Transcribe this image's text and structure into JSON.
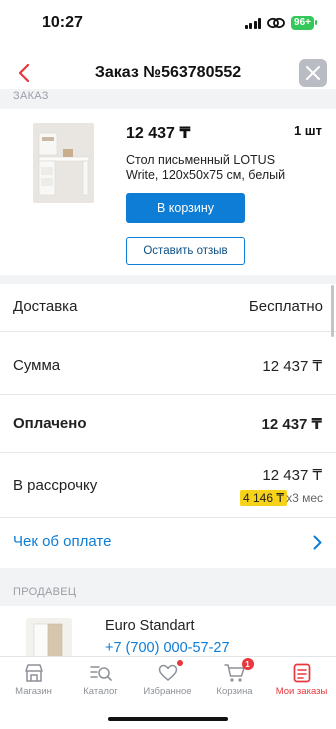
{
  "status_bar": {
    "time": "10:27",
    "battery": "96+"
  },
  "header": {
    "title": "Заказ №563780552"
  },
  "section_order_label": "ЗАКАЗ",
  "product": {
    "price": "12 437 ₸",
    "quantity": "1 шт",
    "name": "Стол письменный LOTUS Write, 120x50x75 см, белый",
    "cart_button": "В корзину",
    "review_button": "Оставить отзыв"
  },
  "rows": {
    "delivery": {
      "label": "Доставка",
      "value": "Бесплатно"
    },
    "sum": {
      "label": "Сумма",
      "value": "12 437 ₸"
    },
    "paid": {
      "label": "Оплачено",
      "value": "12 437 ₸"
    },
    "installment": {
      "label": "В рассрочку",
      "value": "12 437 ₸",
      "monthly": "4 146 ₸",
      "suffix": "х3 мес"
    },
    "receipt": {
      "label": "Чек об оплате"
    }
  },
  "seller": {
    "section_label": "ПРОДАВЕЦ",
    "name": "Euro Standart",
    "phone": "+7 (700) 000-57-27"
  },
  "bottom_nav": [
    {
      "label": "Магазин",
      "icon": "shop-icon"
    },
    {
      "label": "Каталог",
      "icon": "catalog-search-icon"
    },
    {
      "label": "Избранное",
      "icon": "heart-icon"
    },
    {
      "label": "Корзина",
      "icon": "cart-icon",
      "badge": "1"
    },
    {
      "label": "Мои заказы",
      "icon": "orders-icon",
      "active": true
    }
  ],
  "colors": {
    "accent_red": "#e8383d",
    "link_blue": "#0d7dd6",
    "highlight_yellow": "#f7d21a"
  }
}
